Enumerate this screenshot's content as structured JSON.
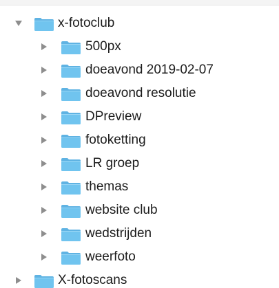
{
  "tree": {
    "root": {
      "label": "x-fotoclub",
      "expanded": true,
      "children": [
        {
          "label": "500px"
        },
        {
          "label": "doeavond 2019-02-07"
        },
        {
          "label": "doeavond resolutie"
        },
        {
          "label": "DPreview"
        },
        {
          "label": "fotoketting"
        },
        {
          "label": "LR groep"
        },
        {
          "label": "themas"
        },
        {
          "label": "website club"
        },
        {
          "label": "wedstrijden"
        },
        {
          "label": "weerfoto"
        }
      ]
    },
    "sibling": {
      "label": "X-fotoscans",
      "expanded": false
    }
  },
  "colors": {
    "folder_body": "#70c4ef",
    "folder_tab": "#5fb3e3",
    "disclosure": "#8e8e8e",
    "text": "#1c1c1c"
  },
  "icons": {
    "folder": "folder-icon",
    "expanded": "disclosure-triangle-down-icon",
    "collapsed": "disclosure-triangle-right-icon"
  }
}
